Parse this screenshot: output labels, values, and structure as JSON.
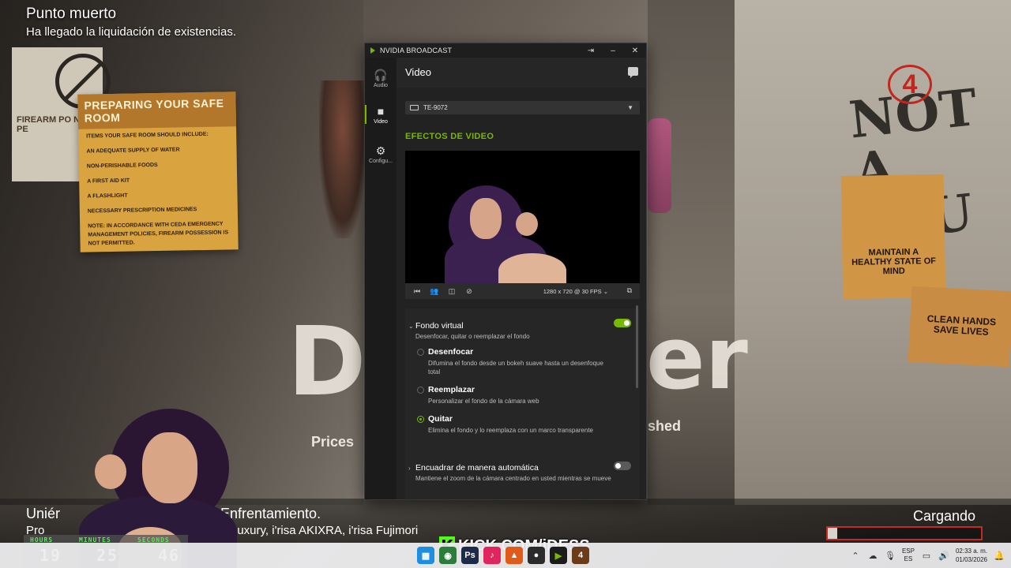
{
  "overlay": {
    "achievement_title": "Punto muerto",
    "achievement_desc": "Ha llegado la liquidación de existencias.",
    "join_line1_left": "Uniér",
    "join_line1_right": "Enfrentamiento.",
    "join_line2_left": "Pro",
    "join_line2_right": "Luxury, i'risa AKIXRA, i'risa Fujimori",
    "loading_label": "Cargando",
    "loading_progress": 0.06,
    "kick_handle": "KICK.COM/iDESS"
  },
  "background": {
    "poster_safe_room_title": "PREPARING YOUR SAFE ROOM",
    "poster_safe_room_lines": [
      "ITEMS YOUR SAFE ROOM SHOULD INCLUDE:",
      "AN ADEQUATE SUPPLY OF WATER",
      "NON-PERISHABLE FOODS",
      "A FIRST AID KIT",
      "A FLASHLIGHT",
      "NECESSARY PRESCRIPTION MEDICINES",
      "NOTE: IN ACCORDANCE WITH CEDA EMERGENCY MANAGEMENT POLICIES, FIREARM POSSESSION IS NOT PERMITTED."
    ],
    "poster_firearm": "FIREARM PO NOT PE",
    "poster_health": "MAINTAIN A HEALTHY STATE OF MIND",
    "poster_clean": "CLEAN HANDS SAVE LIVES",
    "graffiti": "NOT A FLU",
    "badge": "4",
    "title_left": "De",
    "title_right": "er",
    "price_text": "Prices",
    "shed_text": "shed"
  },
  "timer": {
    "hours_label": "HOURS",
    "minutes_label": "MINUTES",
    "seconds_label": "SECONDS",
    "hours": "19",
    "minutes": "25",
    "seconds": "46"
  },
  "nvidia": {
    "app_title": "NVIDIA BROADCAST",
    "nav": [
      {
        "label": "Audio",
        "icon": "headphones-icon"
      },
      {
        "label": "Video",
        "icon": "camera-icon"
      },
      {
        "label": "Configu...",
        "icon": "gear-icon"
      }
    ],
    "page_title": "Video",
    "device": "TE-9072",
    "section_title": "EFECTOS DE VIDEO",
    "resolution": "1280 x 720 @ 30 FPS",
    "effects": [
      {
        "name": "Fondo virtual",
        "desc": "Desenfocar, quitar o reemplazar el fondo",
        "enabled": true,
        "options": [
          {
            "name": "Desenfocar",
            "desc": "Difumina el fondo desde un bokeh suave hasta un desenfoque total",
            "selected": false
          },
          {
            "name": "Reemplazar",
            "desc": "Personalizar el fondo de la cámara web",
            "selected": false
          },
          {
            "name": "Quitar",
            "desc": "Elimina el fondo y lo reemplaza con un marco transparente",
            "selected": true
          }
        ]
      },
      {
        "name": "Encuadrar de manera automática",
        "desc": "Mantiene el zoom de la cámara centrado en usted mientras se mueve",
        "enabled": false
      }
    ]
  },
  "taskbar": {
    "lang_top": "ESP",
    "lang_bottom": "ES",
    "time": "02:33 a. m.",
    "date": "01/03/2026"
  },
  "colors": {
    "nvidia_green": "#76b900",
    "kick_green": "#53fc18",
    "loading_border": "#c52a22"
  }
}
